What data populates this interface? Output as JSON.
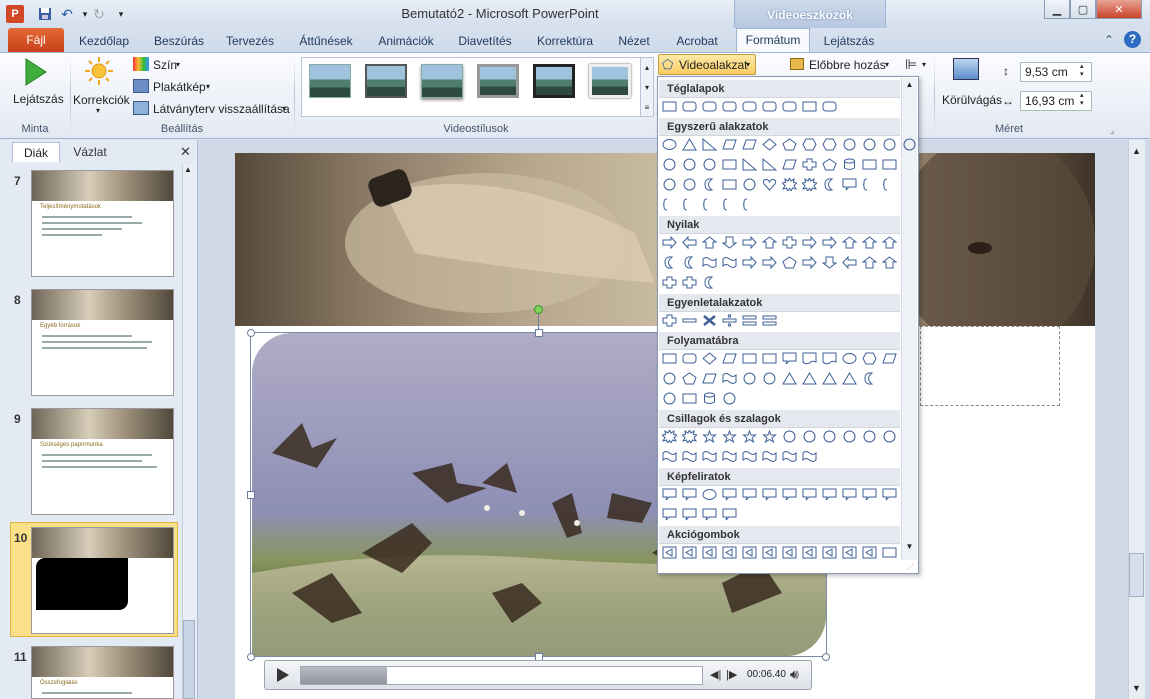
{
  "window": {
    "title": "Bemutató2 - Microsoft PowerPoint",
    "contextual_tab": "Videoeszközök"
  },
  "tabs": [
    "Fájl",
    "Kezdőlap",
    "Beszúrás",
    "Tervezés",
    "Áttűnések",
    "Animációk",
    "Diavetítés",
    "Korrektúra",
    "Nézet",
    "Acrobat",
    "Formátum",
    "Lejátszás"
  ],
  "ribbon": {
    "play_label": "Lejátszás",
    "corrections_label": "Korrekciók",
    "color_label": "Szín",
    "poster_label": "Plakátkép",
    "reset_label": "Látványterv visszaállítása",
    "video_shape_label": "Videoalakzat",
    "bring_forward_label": "Előbbre hozás",
    "crop_label": "Körülvágás",
    "height_value": "9,53 cm",
    "width_value": "16,93 cm",
    "groups": {
      "preview": "Minta",
      "adjust": "Beállítás",
      "styles": "Videostílusok",
      "size": "Méret"
    }
  },
  "panel": {
    "tab_slides": "Diák",
    "tab_outline": "Vázlat",
    "close_glyph": "✕",
    "slides": [
      {
        "num": "7",
        "title": "Teljesítménymutatások"
      },
      {
        "num": "8",
        "title": "Egyéb források"
      },
      {
        "num": "9",
        "title": "Szükséges papírmunka"
      },
      {
        "num": "10",
        "title": ""
      },
      {
        "num": "11",
        "title": "Összefoglalás"
      }
    ]
  },
  "video": {
    "time": "00:06.40"
  },
  "shape_menu": {
    "categories": [
      "Téglalapok",
      "Egyszerű alakzatok",
      "Nyilak",
      "Egyenletalakzatok",
      "Folyamatábra",
      "Csillagok és szalagok",
      "Képfeliratok",
      "Akciógombok"
    ],
    "number_shapes": [
      "7",
      "8",
      "10",
      "12"
    ],
    "star_numbers": [
      "8",
      "10",
      "12",
      "16",
      "24",
      "32"
    ]
  },
  "colors": {
    "file_tab": "#d0471e",
    "selection": "#fbe08a",
    "contextual": "#b6c7e1"
  }
}
